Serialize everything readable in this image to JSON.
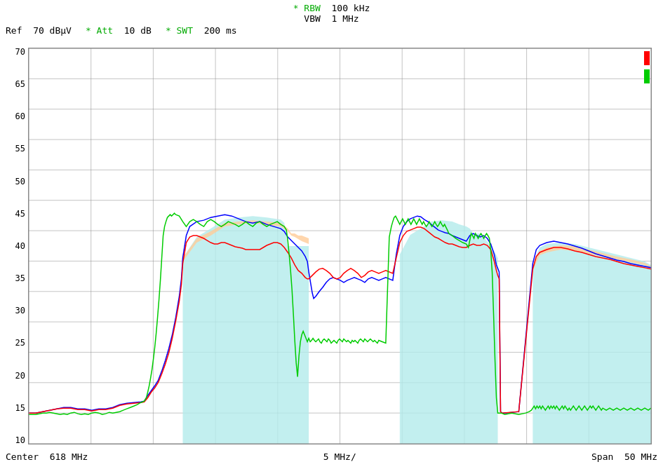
{
  "header": {
    "rbw_label": "* RBW",
    "rbw_value": "100 kHz",
    "vbw_label": "VBW",
    "vbw_value": "1 MHz",
    "ref_label": "Ref",
    "ref_value": "70 dBµV",
    "att_label": "* Att",
    "att_value": "10 dB",
    "swt_label": "* SWT",
    "swt_value": "200 ms"
  },
  "yAxis": {
    "labels": [
      "70",
      "65",
      "60",
      "55",
      "50",
      "45",
      "40",
      "35",
      "30",
      "25",
      "20",
      "15",
      "10"
    ]
  },
  "footer": {
    "center_label": "Center",
    "center_value": "618 MHz",
    "div_label": "5 MHz/",
    "span_label": "Span",
    "span_value": "50 MHz"
  },
  "colors": {
    "grid": "#888888",
    "cyan_fill": "#b3f0f0",
    "red": "#ff0000",
    "blue": "#0000ff",
    "green": "#00cc00",
    "orange_fill": "#ffcc99"
  }
}
